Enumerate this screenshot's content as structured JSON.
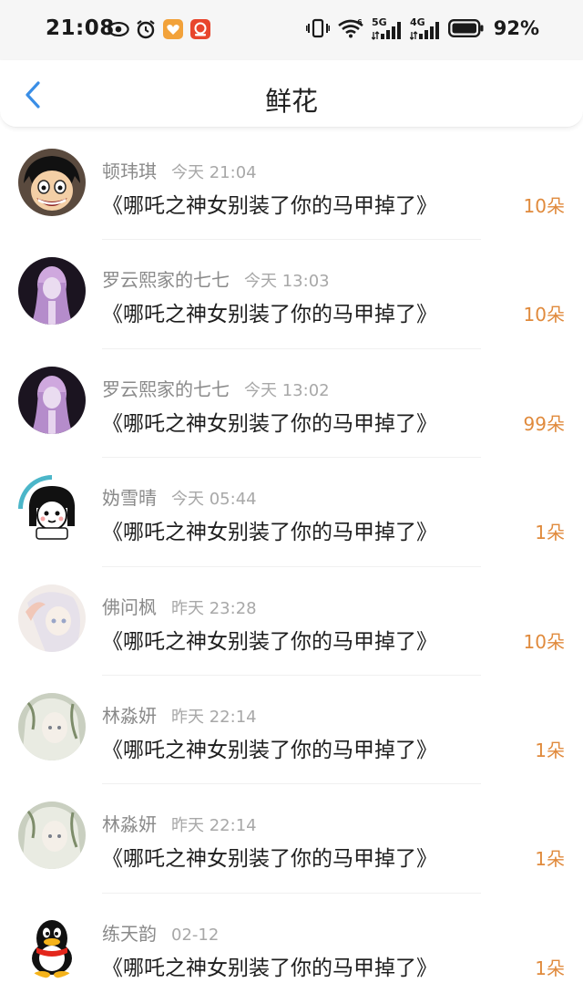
{
  "status_bar": {
    "time": "21:08",
    "network_5g": "5G",
    "network_4g": "4G",
    "battery_pct": "92%"
  },
  "header": {
    "title": "鲜花",
    "back_icon": "chevron-left-icon"
  },
  "colors": {
    "accent_blue": "#3a8ee6",
    "count_orange": "#e08a3c",
    "name_gray": "#8a8a8a"
  },
  "gifts": [
    {
      "name": "顿玮琪",
      "time": "今天 21:04",
      "message": "《哪吒之神女别装了你的马甲掉了》",
      "count": "10朵"
    },
    {
      "name": "罗云熙家的七七",
      "time": "今天 13:03",
      "message": "《哪吒之神女别装了你的马甲掉了》",
      "count": "10朵"
    },
    {
      "name": "罗云熙家的七七",
      "time": "今天 13:02",
      "message": "《哪吒之神女别装了你的马甲掉了》",
      "count": "99朵"
    },
    {
      "name": "妫雪晴",
      "time": "今天 05:44",
      "message": "《哪吒之神女别装了你的马甲掉了》",
      "count": "1朵"
    },
    {
      "name": "佛问枫",
      "time": "昨天 23:28",
      "message": "《哪吒之神女别装了你的马甲掉了》",
      "count": "10朵"
    },
    {
      "name": "林淼妍",
      "time": "昨天 22:14",
      "message": "《哪吒之神女别装了你的马甲掉了》",
      "count": "1朵"
    },
    {
      "name": "林淼妍",
      "time": "昨天 22:14",
      "message": "《哪吒之神女别装了你的马甲掉了》",
      "count": "1朵"
    },
    {
      "name": "练天韵",
      "time": "02-12",
      "message": "《哪吒之神女别装了你的马甲掉了》",
      "count": "1朵"
    }
  ]
}
